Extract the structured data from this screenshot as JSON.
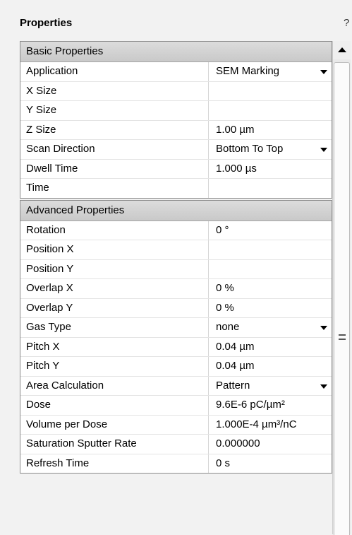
{
  "header": {
    "title": "Properties",
    "help_label": "?"
  },
  "sections": {
    "basic": {
      "title": "Basic Properties",
      "rows": [
        {
          "label": "Application",
          "value": "SEM Marking",
          "dropdown": true
        },
        {
          "label": "X Size",
          "value": ""
        },
        {
          "label": "Y Size",
          "value": ""
        },
        {
          "label": "Z Size",
          "value": "1.00 µm"
        },
        {
          "label": "Scan Direction",
          "value": "Bottom To Top",
          "dropdown": true
        },
        {
          "label": "Dwell Time",
          "value": "1.000 µs"
        },
        {
          "label": "Time",
          "value": ""
        }
      ]
    },
    "advanced": {
      "title": "Advanced Properties",
      "rows": [
        {
          "label": "Rotation",
          "value": "0 °"
        },
        {
          "label": "Position X",
          "value": ""
        },
        {
          "label": "Position Y",
          "value": ""
        },
        {
          "label": "Overlap X",
          "value": "0 %"
        },
        {
          "label": "Overlap Y",
          "value": "0 %"
        },
        {
          "label": "Gas Type",
          "value": "none",
          "dropdown": true
        },
        {
          "label": "Pitch X",
          "value": "0.04 µm"
        },
        {
          "label": "Pitch Y",
          "value": "0.04 µm"
        },
        {
          "label": "Area Calculation",
          "value": "Pattern",
          "dropdown": true
        },
        {
          "label": "Dose",
          "value": "9.6E-6 pC/µm²"
        },
        {
          "label": "Volume per Dose",
          "value": "1.000E-4 µm³/nC"
        },
        {
          "label": "Saturation Sputter Rate",
          "value": "0.000000"
        },
        {
          "label": "Refresh Time",
          "value": "0 s"
        }
      ]
    }
  },
  "scrollbar": {
    "up_icon": "arrow-up-icon",
    "grip_icon": "grip-icon"
  }
}
